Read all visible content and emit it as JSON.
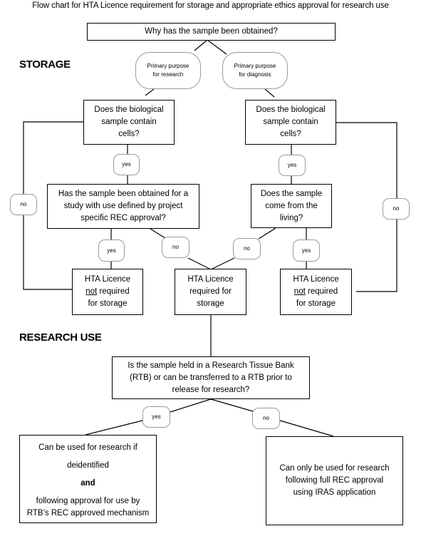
{
  "title": "Flow chart for HTA Licence requirement for storage and appropriate ethics approval for research use",
  "sections": {
    "storage": "STORAGE",
    "research_use": "RESEARCH USE"
  },
  "nodes": {
    "start": "Why has the sample been obtained?",
    "purpose_research": [
      "Primary purpose",
      "for research"
    ],
    "purpose_diagnosis": [
      "Primary purpose",
      "for diagnosis"
    ],
    "cells_left": [
      "Does the biological",
      "sample contain",
      "cells?"
    ],
    "cells_right": [
      "Does the biological",
      "sample contain",
      "cells?"
    ],
    "rec_study": [
      "Has the sample been obtained for a",
      "study with use defined by project",
      "specific REC approval?"
    ],
    "living": [
      "Does the sample",
      "come from the",
      "living?"
    ],
    "not_required_left": {
      "line1": "HTA Licence",
      "emph": "not",
      "rest": " required",
      "line3": "for storage"
    },
    "required": [
      "HTA Licence",
      "required for",
      "storage"
    ],
    "not_required_right": {
      "line1": "HTA Licence",
      "emph": "not",
      "rest": " required",
      "line3": "for storage"
    },
    "rtb": [
      "Is the sample held in a Research Tissue Bank",
      "(RTB) or can be transferred to a RTB prior to",
      "release for research?"
    ],
    "rtb_yes_outcome": {
      "line1": "Can be used for research if",
      "line2": "deidentified",
      "and": "and",
      "line4": "following approval for use by",
      "line5": "RTB’s REC approved mechanism"
    },
    "rtb_no_outcome": [
      "Can only be used for research",
      "following full REC approval",
      "using IRAS application"
    ]
  },
  "edge_labels": {
    "yes": "yes",
    "no": "no"
  }
}
